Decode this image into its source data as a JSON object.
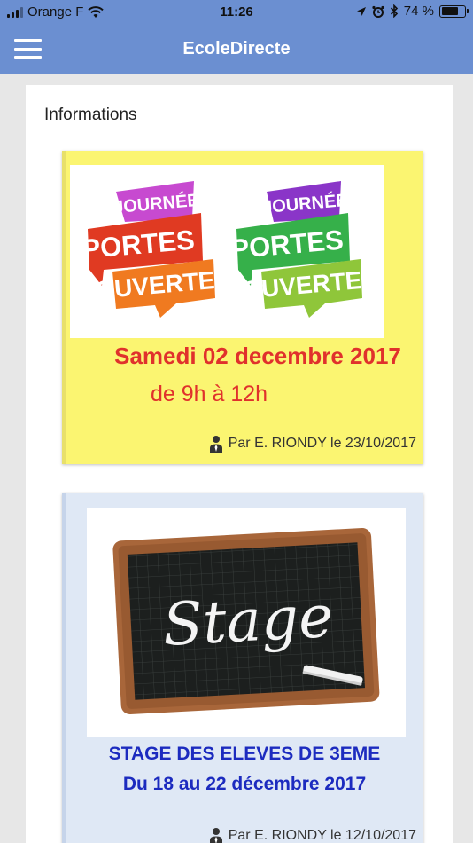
{
  "status_bar": {
    "carrier": "Orange F",
    "time": "11:26",
    "battery_text": "74 %",
    "battery_level": 0.74
  },
  "header": {
    "title": "EcoleDirecte",
    "menu_icon": "hamburger-menu-icon"
  },
  "main": {
    "section_title": "Informations",
    "cards": [
      {
        "background": "#fbf571",
        "image_text": [
          "JOURNÉE",
          "PORTES",
          "OUVERTES"
        ],
        "lines": [
          "Samedi 02 decembre 2017",
          "de 9h à 12h"
        ],
        "line_color": "#e0312c",
        "byline": "Par E. RIONDY le 23/10/2017"
      },
      {
        "background": "#dfe8f5",
        "image_text": "Stage",
        "lines": [
          "STAGE DES ELEVES DE 3EME",
          "Du 18 au 22 décembre 2017"
        ],
        "line_color": "#1c2bbf",
        "byline": "Par E. RIONDY le 12/10/2017"
      }
    ]
  }
}
